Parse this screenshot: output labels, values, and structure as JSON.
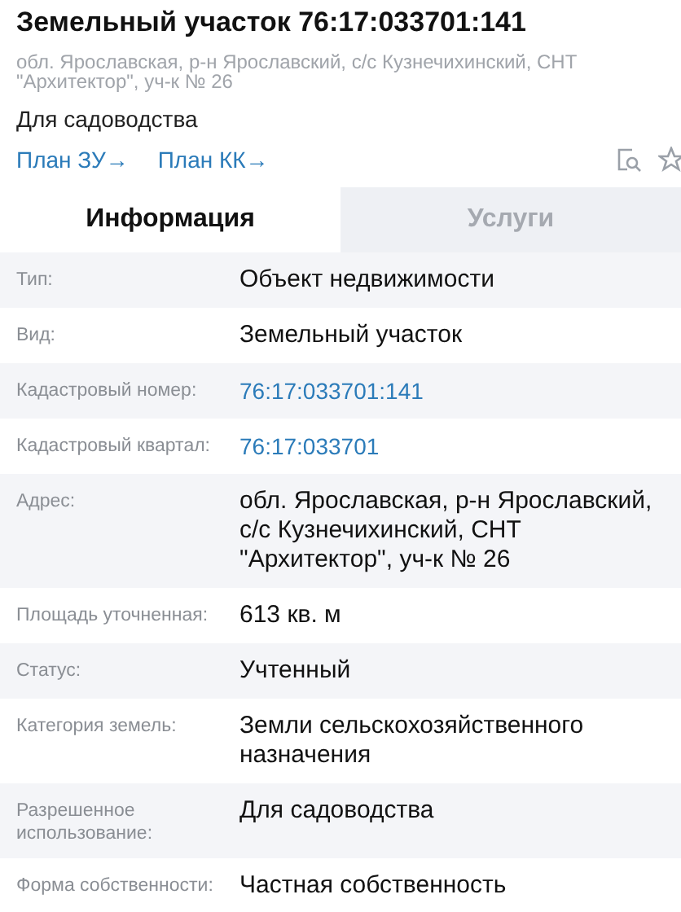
{
  "header": {
    "title": "Земельный участок 76:17:033701:141",
    "address": "обл. Ярославская, р-н Ярославский, с/с Кузнечихинский, СНТ \"Архитектор\", уч-к № 26",
    "purpose": "Для садоводства",
    "links": [
      {
        "label": "План ЗУ→"
      },
      {
        "label": "План КК→"
      }
    ]
  },
  "tabs": [
    {
      "label": "Информация",
      "selected": true
    },
    {
      "label": "Услуги",
      "selected": false
    }
  ],
  "rows": [
    {
      "label": "Тип:",
      "value": "Объект недвижимости",
      "kind": "text"
    },
    {
      "label": "Вид:",
      "value": "Земельный участок",
      "kind": "text"
    },
    {
      "label": "Кадастровый номер:",
      "value": "76:17:033701:141",
      "kind": "link"
    },
    {
      "label": "Кадастровый квартал:",
      "value": "76:17:033701",
      "kind": "link"
    },
    {
      "label": "Адрес:",
      "value": "обл. Ярославская, р-н Ярославский, с/с Кузнечихинский, СНТ \"Архитектор\", уч-к № 26",
      "kind": "text"
    },
    {
      "label": "Площадь уточненная:",
      "value": "613 кв. м",
      "kind": "text"
    },
    {
      "label": "Статус:",
      "value": "Учтенный",
      "kind": "text"
    },
    {
      "label": "Категория земель:",
      "value": "Земли сельскохозяйственного назначения",
      "kind": "text"
    },
    {
      "label": "Разрешенное использование:",
      "value": "Для садоводства",
      "kind": "text"
    },
    {
      "label": "Форма собственности:",
      "value": "Частная собственность",
      "kind": "text"
    }
  ]
}
